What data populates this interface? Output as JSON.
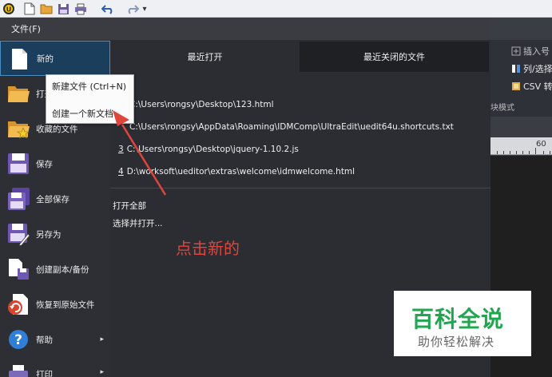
{
  "toolbar": {
    "icons": [
      "app-logo-icon",
      "new-file-icon",
      "open-folder-icon",
      "save-icon",
      "print-icon",
      "undo-icon",
      "redo-icon",
      "customize-dropdown-icon"
    ],
    "customize_glyph": "▾"
  },
  "backstage": {
    "title": "文件(F)",
    "menu": [
      {
        "label": "新的",
        "icon": "new-document-icon",
        "selected": true
      },
      {
        "label": "打开",
        "icon": "open-folder-icon"
      },
      {
        "label": "收藏的文件",
        "icon": "favorite-folder-icon"
      },
      {
        "label": "保存",
        "icon": "save-icon"
      },
      {
        "label": "全部保存",
        "icon": "save-all-icon"
      },
      {
        "label": "另存为",
        "icon": "save-as-icon"
      },
      {
        "label": "创建副本/备份",
        "icon": "backup-icon"
      },
      {
        "label": "恢复到原始文件",
        "icon": "revert-icon"
      },
      {
        "label": "帮助",
        "icon": "help-icon",
        "submenu_arrow": "▸"
      },
      {
        "label": "打印",
        "icon": "print-icon",
        "submenu_arrow": "▸"
      }
    ],
    "tabs": {
      "recent": "最近打开",
      "recently_closed": "最近关闭的文件"
    },
    "recent_files": [
      {
        "num": "",
        "path": "C:\\Users\\rongsy\\Desktop\\123.html"
      },
      {
        "num": "",
        "path": "C:\\Users\\rongsy\\AppData\\Roaming\\IDMComp\\UltraEdit\\uedit64u.shortcuts.txt"
      },
      {
        "num": "3",
        "path": "C:\\Users\\rongsy\\Desktop\\jquery-1.10.2.js"
      },
      {
        "num": "4",
        "path": "D:\\worksoft\\ueditor\\extras\\welcome\\idmwelcome.html"
      }
    ],
    "actions": {
      "open_all": "打开全部",
      "select_open": "选择并打开..."
    },
    "instruction": "点击新的"
  },
  "dropdown": {
    "new_file": "新建文件 (Ctrl+N)",
    "create_doc": "创建一个新文档"
  },
  "background_app": {
    "ribbon": {
      "insert": "插入号",
      "column_select": "列/选择",
      "csv": "CSV 转"
    },
    "block_mode": "块模式",
    "ruler_label": "60"
  },
  "watermark": {
    "title": "百科全说",
    "subtitle": "助你轻松解决"
  },
  "colors": {
    "accent": "#4a8fc4",
    "instruction": "#e0453d",
    "watermark_green": "#21a650"
  }
}
